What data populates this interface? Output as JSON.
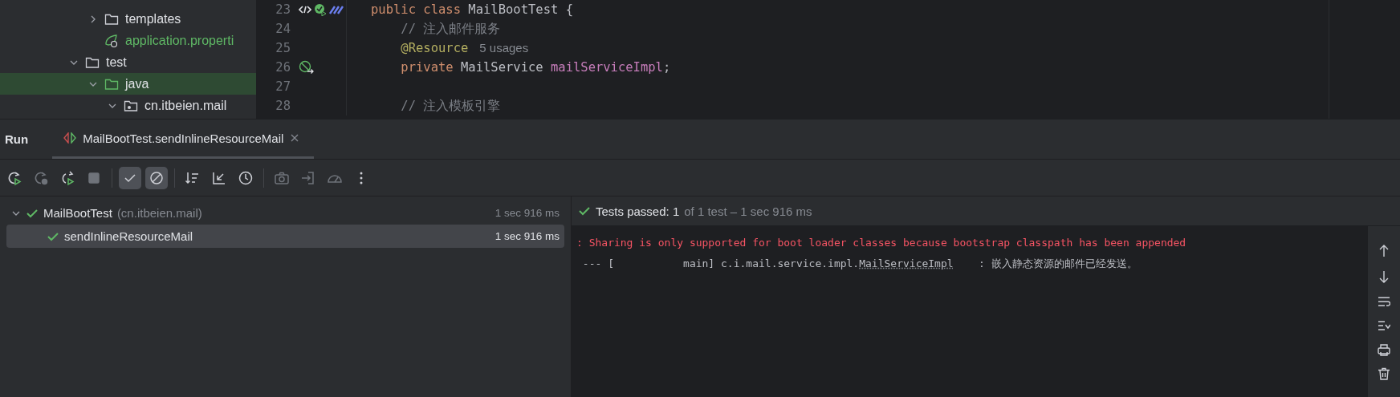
{
  "project_tree": {
    "cut_parent_children": [
      {
        "label": "templates",
        "kind": "folder",
        "expanded": false,
        "selected": false,
        "color": "#dfe1e5"
      },
      {
        "label": "application.properti",
        "kind": "spring",
        "selected": false,
        "color": "#5fb865"
      }
    ],
    "roots": [
      {
        "label": "test",
        "kind": "folder",
        "expanded": true,
        "selected": false,
        "color": "#dfe1e5",
        "children": [
          {
            "label": "java",
            "kind": "source",
            "expanded": true,
            "selected": true,
            "color": "#dfe1e5",
            "children": [
              {
                "label": "cn.itbeien.mail",
                "kind": "package",
                "expanded": true,
                "selected": false,
                "color": "#dfe1e5"
              }
            ]
          }
        ]
      }
    ]
  },
  "editor": {
    "lines": [
      {
        "number": "23",
        "kind": "class-declaration",
        "tokens": [
          {
            "text": "public class ",
            "kind": "keyword"
          },
          {
            "text": "MailBootTest {",
            "kind": "plain"
          }
        ]
      },
      {
        "number": "24",
        "kind": "plain",
        "tokens": [
          {
            "text": "    // 注入邮件服务",
            "kind": "comment"
          }
        ]
      },
      {
        "number": "25",
        "kind": "plain",
        "tokens": [
          {
            "text": "    @Resource",
            "kind": "annotation"
          },
          {
            "text": "5 usages",
            "kind": "hint"
          }
        ]
      },
      {
        "number": "26",
        "kind": "injected-field",
        "tokens": [
          {
            "text": "    private ",
            "kind": "keyword"
          },
          {
            "text": "MailService ",
            "kind": "plain"
          },
          {
            "text": "mailServiceImpl",
            "kind": "field"
          },
          {
            "text": ";",
            "kind": "plain"
          }
        ]
      },
      {
        "number": "27",
        "kind": "plain"
      },
      {
        "number": "28",
        "kind": "plain",
        "tokens": [
          {
            "text": "    // 注入模板引擎",
            "kind": "comment"
          }
        ]
      }
    ]
  },
  "run_panel": {
    "title": "Run",
    "tabs": [
      {
        "label": "MailBootTest.sendInlineResourceMail",
        "selected": true
      }
    ]
  },
  "toolbar_groups": [
    {
      "buttons": [
        {
          "kind": "rerun",
          "disabled": false,
          "selected": false
        },
        {
          "kind": "rerun-failed",
          "disabled": true,
          "selected": false
        },
        {
          "kind": "rerun-pending",
          "disabled": false,
          "selected": false
        },
        {
          "kind": "stop",
          "disabled": true,
          "selected": false
        }
      ]
    },
    {
      "buttons": [
        {
          "kind": "show-passed",
          "disabled": false,
          "selected": true
        },
        {
          "kind": "show-ignored",
          "disabled": false,
          "selected": true
        }
      ]
    },
    {
      "buttons": [
        {
          "kind": "sort",
          "disabled": false,
          "selected": false
        },
        {
          "kind": "collapse",
          "disabled": false,
          "selected": false
        },
        {
          "kind": "history",
          "disabled": false,
          "selected": false
        }
      ]
    },
    {
      "buttons": [
        {
          "kind": "camera",
          "disabled": true,
          "selected": false
        },
        {
          "kind": "import",
          "disabled": true,
          "selected": false
        },
        {
          "kind": "gauge",
          "disabled": true,
          "selected": false
        },
        {
          "kind": "more",
          "disabled": false,
          "selected": false
        }
      ]
    }
  ],
  "test_tree": [
    {
      "name": "MailBootTest",
      "package": "(cn.itbeien.mail)",
      "time": "1 sec 916 ms",
      "passed": true,
      "expanded": true,
      "selected": false,
      "children": [
        {
          "name": "sendInlineResourceMail",
          "time": "1 sec 916 ms",
          "passed": true,
          "selected": true
        }
      ]
    }
  ],
  "summary": {
    "label": "Tests passed: 1",
    "detail": "of 1 test – 1 sec 916 ms",
    "passed": true
  },
  "console": [
    {
      "kind": "error",
      "text": ": Sharing is only supported for boot loader classes because bootstrap classpath has been appended"
    },
    {
      "kind": "info",
      "text": " --- [           main] c.i.mail.service.impl.",
      "link_text": "MailServiceImpl",
      "text_after": "    : 嵌入静态资源的邮件已经发送。"
    }
  ]
}
